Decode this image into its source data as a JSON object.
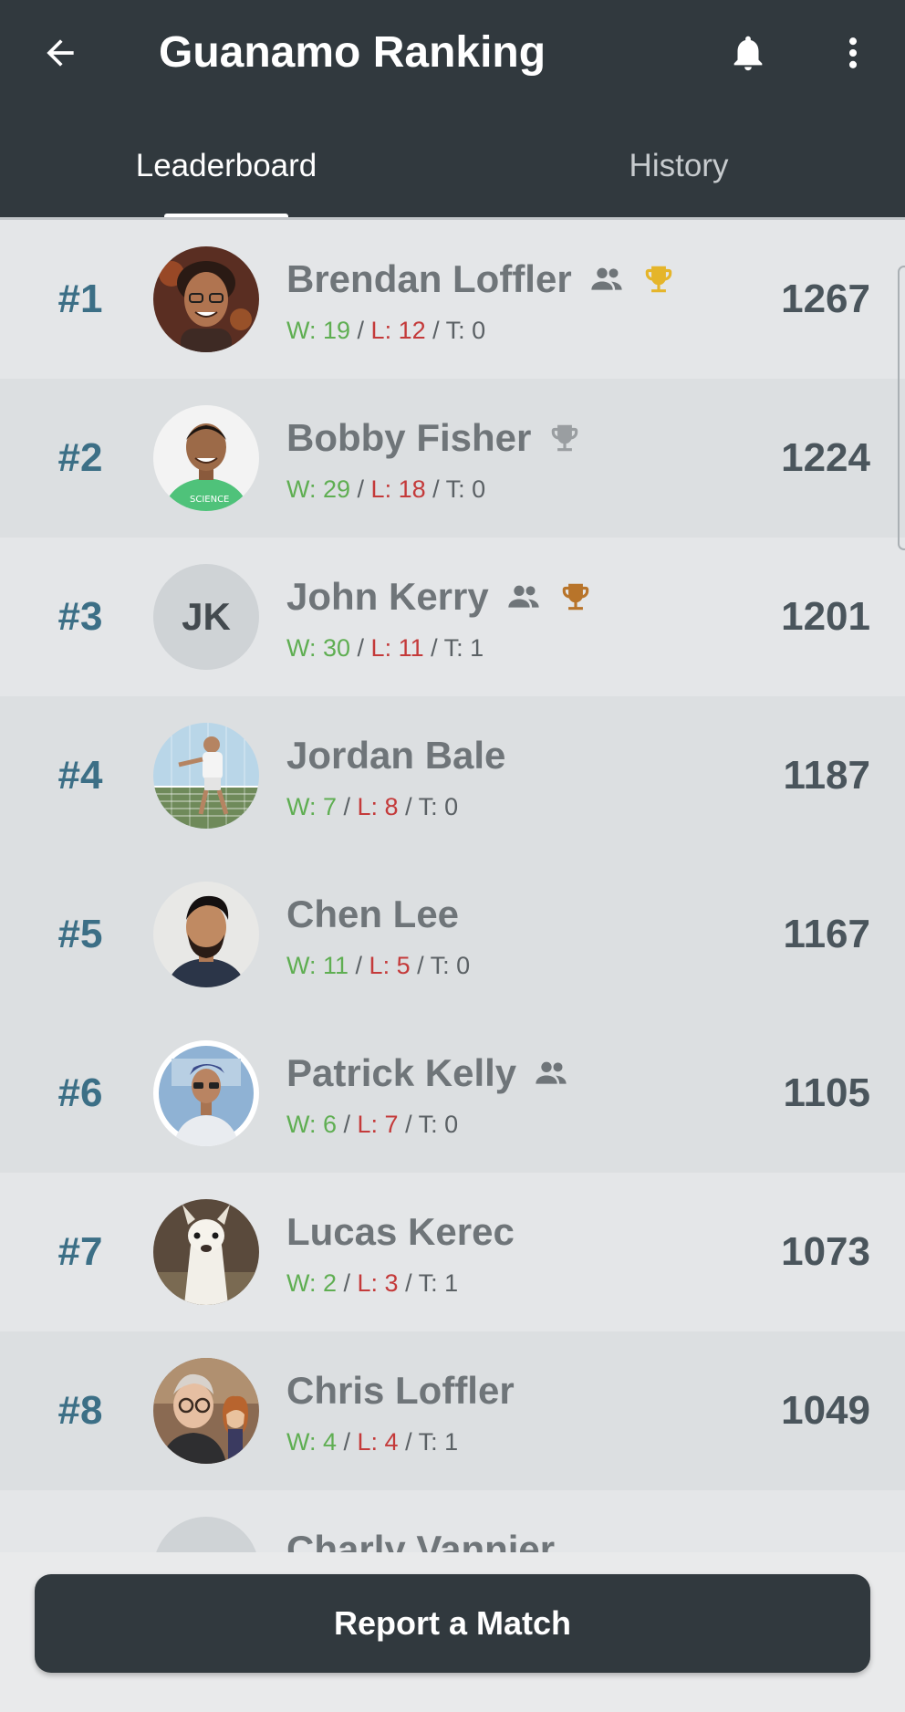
{
  "header": {
    "title": "Guanamo Ranking",
    "back_icon": "arrow-back-icon",
    "notification_icon": "bell-icon",
    "more_icon": "more-vertical-icon"
  },
  "tabs": [
    {
      "label": "Leaderboard",
      "selected": true
    },
    {
      "label": "History",
      "selected": false
    }
  ],
  "colors": {
    "app_bar": "#31393e",
    "rank": "#3c6f86",
    "wins": "#5fae52",
    "losses": "#c43a3a",
    "trophy_gold": "#e5b52a",
    "trophy_silver": "#9a9ea1",
    "trophy_bronze": "#b8742a"
  },
  "players": [
    {
      "rank": "#1",
      "name": "Brendan Loffler",
      "w": "W: 19",
      "l": "L: 12",
      "t": "T: 0",
      "score": "1267",
      "avatar": "photo",
      "group_icon": true,
      "trophy": "gold"
    },
    {
      "rank": "#2",
      "name": "Bobby Fisher",
      "w": "W: 29",
      "l": "L: 18",
      "t": "T: 0",
      "score": "1224",
      "avatar": "photo",
      "group_icon": false,
      "trophy": "silver"
    },
    {
      "rank": "#3",
      "name": "John Kerry",
      "w": "W: 30",
      "l": "L: 11",
      "t": "T: 1",
      "score": "1201",
      "avatar": "initials",
      "initials": "JK",
      "group_icon": true,
      "trophy": "bronze"
    },
    {
      "rank": "#4",
      "name": "Jordan Bale",
      "w": "W: 7",
      "l": "L: 8",
      "t": "T: 0",
      "score": "1187",
      "avatar": "photo",
      "group_icon": false,
      "trophy": "none"
    },
    {
      "rank": "#5",
      "name": "Chen Lee",
      "w": "W: 11",
      "l": "L: 5",
      "t": "T: 0",
      "score": "1167",
      "avatar": "photo",
      "group_icon": false,
      "trophy": "none"
    },
    {
      "rank": "#6",
      "name": "Patrick Kelly",
      "w": "W: 6",
      "l": "L: 7",
      "t": "T: 0",
      "score": "1105",
      "avatar": "photo",
      "group_icon": true,
      "trophy": "none"
    },
    {
      "rank": "#7",
      "name": "Lucas Kerec",
      "w": "W: 2",
      "l": "L: 3",
      "t": "T: 1",
      "score": "1073",
      "avatar": "photo",
      "group_icon": false,
      "trophy": "none"
    },
    {
      "rank": "#8",
      "name": "Chris Loffler",
      "w": "W: 4",
      "l": "L: 4",
      "t": "T: 1",
      "score": "1049",
      "avatar": "photo",
      "group_icon": false,
      "trophy": "none"
    },
    {
      "rank": "",
      "name": "Charly Vannier",
      "w": "",
      "l": "",
      "t": "",
      "score": "",
      "avatar": "initials",
      "initials": "",
      "group_icon": false,
      "trophy": "none",
      "partially_visible": true
    }
  ],
  "footer": {
    "report_button_label": "Report a Match"
  }
}
